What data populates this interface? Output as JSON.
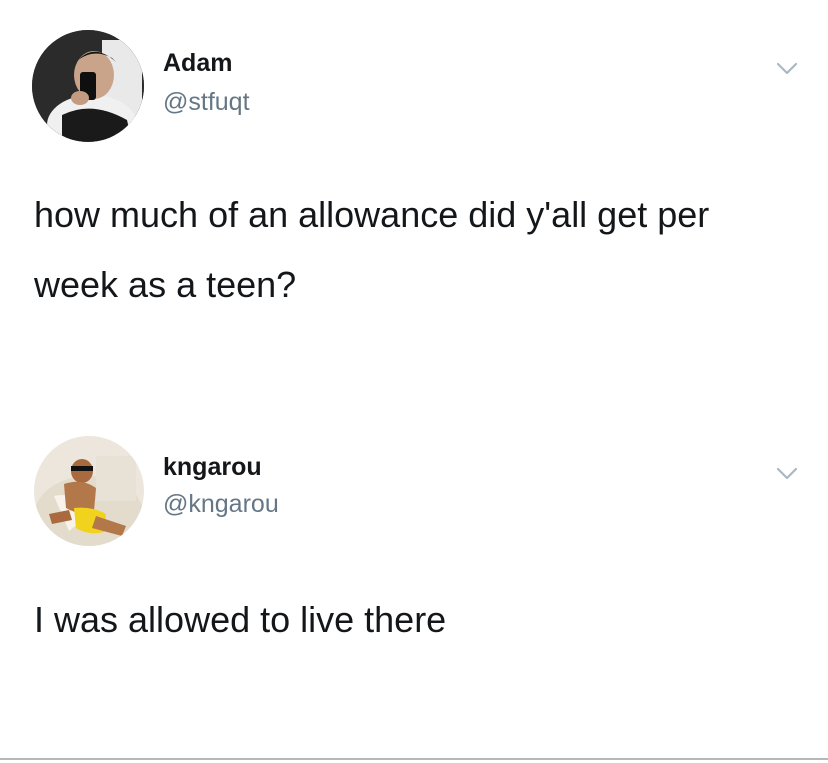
{
  "tweets": [
    {
      "name": "Adam",
      "handle": "@stfuqt",
      "text": "how much of an allowance did y'all get per week as a teen?",
      "avatar_icon": "profile-photo-icon",
      "menu_icon": "chevron-down-icon"
    },
    {
      "name": "kngarou",
      "handle": "@kngarou",
      "text": "I was allowed to live there",
      "avatar_icon": "profile-photo-icon",
      "menu_icon": "chevron-down-icon"
    }
  ],
  "colors": {
    "text": "#14171a",
    "handle": "#657786",
    "chevron": "#aab8c2",
    "background": "#ffffff"
  }
}
